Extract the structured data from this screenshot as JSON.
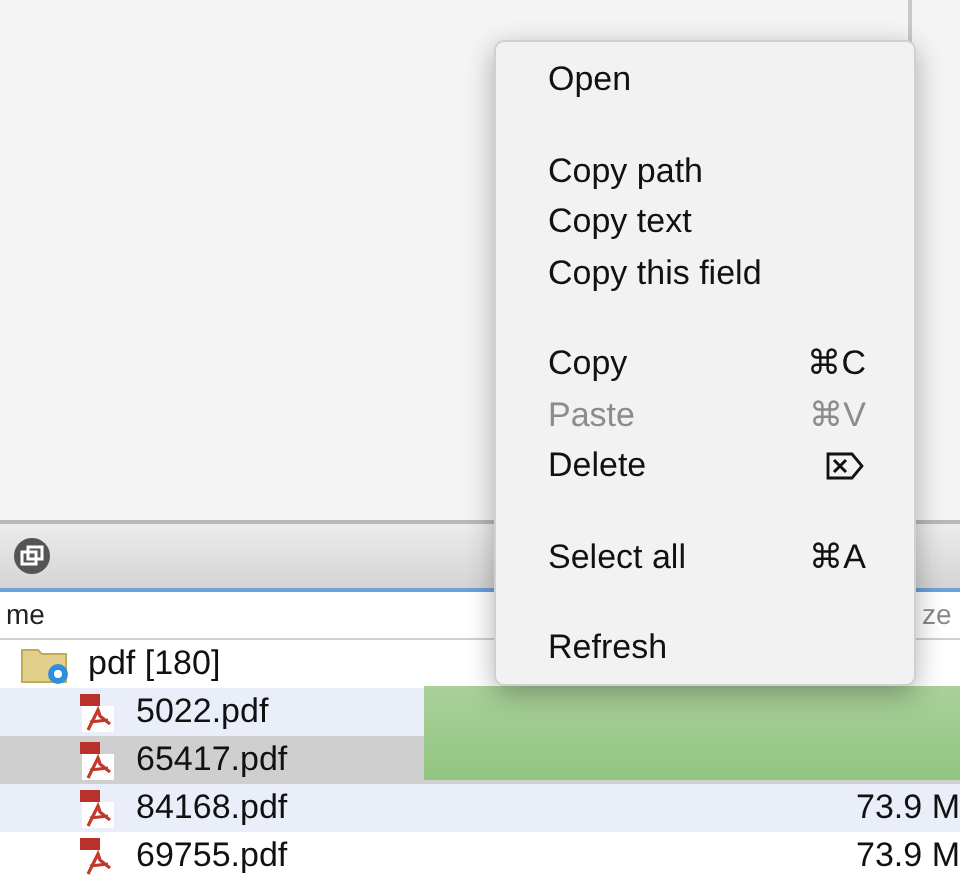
{
  "table": {
    "columns": [
      {
        "label": "me"
      },
      {
        "label": "ze"
      }
    ],
    "rows": [
      {
        "name": "pdf [180]",
        "kind": "folder",
        "expanded": true,
        "children": [
          {
            "name": "5022.pdf",
            "kind": "pdf",
            "selected": false
          },
          {
            "name": "65417.pdf",
            "kind": "pdf",
            "selected": true
          },
          {
            "name": "84168.pdf",
            "kind": "pdf",
            "selected": false,
            "size": "73.9 M"
          },
          {
            "name": "69755.pdf",
            "kind": "pdf",
            "selected": false,
            "size": "73.9 M"
          }
        ]
      }
    ]
  },
  "context_menu": {
    "items": [
      {
        "kind": "item",
        "label": "Open",
        "disabled": false
      },
      {
        "kind": "separator"
      },
      {
        "kind": "item",
        "label": "Copy path",
        "disabled": false
      },
      {
        "kind": "item",
        "label": "Copy text",
        "disabled": false
      },
      {
        "kind": "item",
        "label": "Copy this field",
        "disabled": false
      },
      {
        "kind": "separator"
      },
      {
        "kind": "item",
        "label": "Copy",
        "shortcut": "⌘C",
        "disabled": false
      },
      {
        "kind": "item",
        "label": "Paste",
        "shortcut": "⌘V",
        "disabled": true
      },
      {
        "kind": "delete_item",
        "label": "Delete",
        "disabled": false
      },
      {
        "kind": "separator"
      },
      {
        "kind": "item",
        "label": "Select all",
        "shortcut": "⌘A",
        "disabled": false
      },
      {
        "kind": "separator"
      },
      {
        "kind": "item",
        "label": "Refresh",
        "disabled": false
      }
    ]
  }
}
